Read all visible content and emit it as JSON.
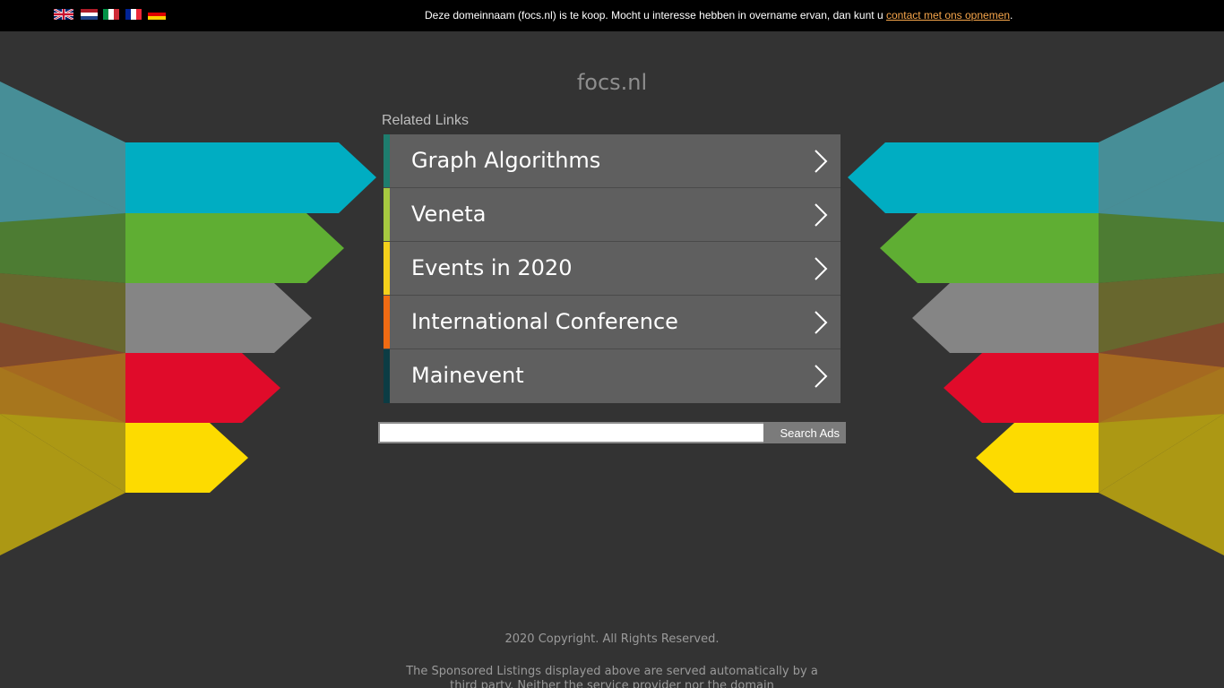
{
  "topbar": {
    "flags": [
      {
        "name": "uk-flag",
        "lang": "English"
      },
      {
        "name": "nl-flag",
        "lang": "Nederlands"
      },
      {
        "name": "it-flag",
        "lang": "Italiano"
      },
      {
        "name": "fr-flag",
        "lang": "Français"
      },
      {
        "name": "de-flag",
        "lang": "Deutsch"
      }
    ],
    "notice_text": "Deze domeinnaam (focs.nl) is te koop. Mocht u interesse hebben in overname ervan, dan kunt u ",
    "notice_link": "contact met ons opnemen",
    "notice_end": "."
  },
  "site": {
    "title": "focs.nl",
    "related_label": "Related Links"
  },
  "links": [
    {
      "label": "Graph Algorithms",
      "color": "#1e7d6e"
    },
    {
      "label": "Veneta",
      "color": "#a6c940"
    },
    {
      "label": "Events in 2020",
      "color": "#f4d01b"
    },
    {
      "label": "International Conference",
      "color": "#f06b13"
    },
    {
      "label": "Mainevent",
      "color": "#0c3c44"
    }
  ],
  "search": {
    "placeholder": "",
    "value": "",
    "button_label": "Search Ads"
  },
  "footer": {
    "copyright": "2020 Copyright. All Rights Reserved.",
    "disclaimer": "The Sponsored Listings displayed above are served automatically by a third party. Neither the service provider nor the domain"
  },
  "colors": {
    "background": "#333333",
    "topbar": "#000000",
    "link_bg": "#5f5f5f",
    "notice_link": "#f7a64b",
    "arrow_cyan": "#00adc2",
    "arrow_green": "#5fae33",
    "arrow_gray": "#858585",
    "arrow_red": "#e00b2a",
    "arrow_yellow": "#fddb00"
  }
}
